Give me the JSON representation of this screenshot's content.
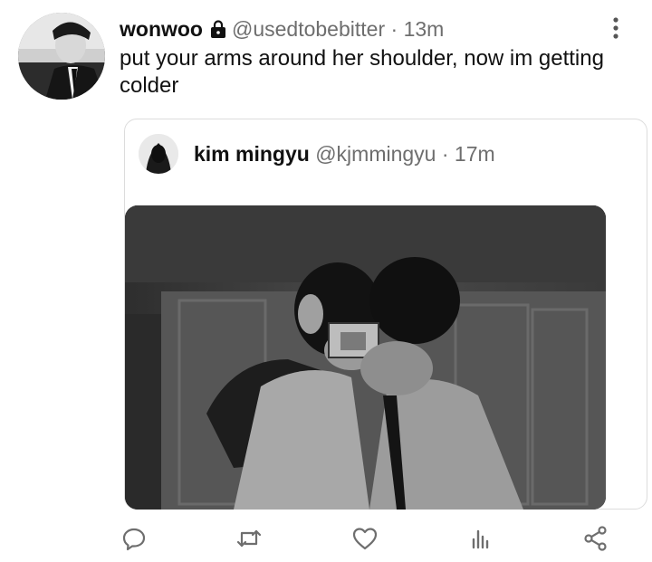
{
  "tweet": {
    "author_name": "wonwoo",
    "author_handle": "@usedtobebitter",
    "separator": "·",
    "time": "13m",
    "text": "put your arms around her shoulder, now im getting colder"
  },
  "quoted_tweet": {
    "author_name": "kim mingyu",
    "author_handle": "@kjmmingyu",
    "separator": "·",
    "time": "17m"
  },
  "icons": {
    "lock": "lock-icon",
    "more": "more-vertical-icon",
    "reply": "reply-icon",
    "retweet": "retweet-icon",
    "like": "heart-icon",
    "views": "analytics-icon",
    "share": "share-icon"
  },
  "colors": {
    "text": "#111111",
    "muted": "#6e6e6e",
    "border": "#dcdcdc",
    "icon": "#6e6e6e"
  }
}
